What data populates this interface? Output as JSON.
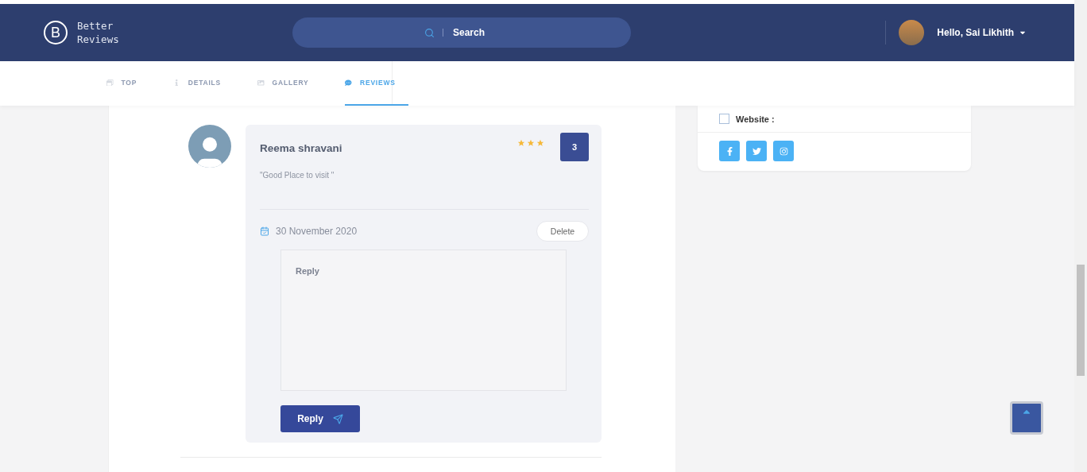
{
  "header": {
    "logo_letter": "B",
    "logo_text": [
      "Better",
      "Reviews"
    ],
    "search": {
      "placeholder": "Search"
    },
    "user": {
      "greeting": "Hello,  Sai Likhith"
    }
  },
  "tabs": [
    {
      "label": "TOP",
      "selected": false,
      "kind": "top"
    },
    {
      "label": "DETAILS",
      "selected": false,
      "kind": "details"
    },
    {
      "label": "GALLERY",
      "selected": false,
      "kind": "gallery"
    },
    {
      "label": "REVIEWS",
      "selected": true,
      "kind": "reviews"
    }
  ],
  "review": {
    "author": "Reema shravani",
    "stars": 3,
    "rating": "3",
    "text": "\"Good Place to visit \"",
    "date": "30 November 2020",
    "delete_label": "Delete",
    "reply": {
      "placeholder": "Reply"
    },
    "reply_button": "Reply"
  },
  "sidebar": {
    "website": {
      "label": "Website :",
      "checked": false
    },
    "socials": [
      {
        "kind": "facebook"
      },
      {
        "kind": "twitter"
      },
      {
        "kind": "instagram"
      }
    ]
  }
}
